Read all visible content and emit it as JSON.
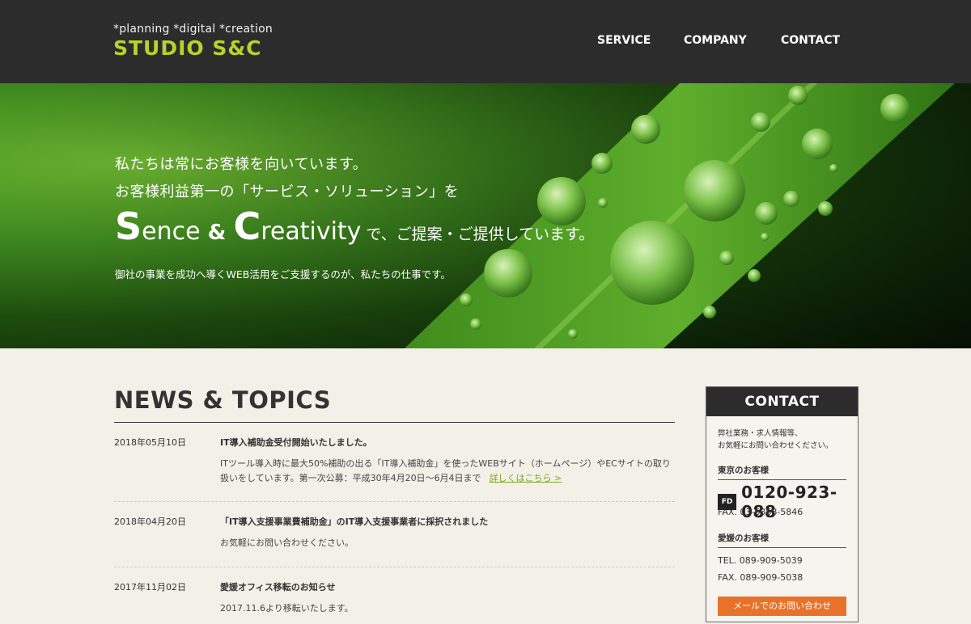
{
  "header": {
    "tagline": "*planning *digital *creation",
    "brand": "STUDIO S&C",
    "nav": [
      "SERVICE",
      "COMPANY",
      "CONTACT"
    ]
  },
  "hero": {
    "line1": "私たちは常にお客様を向いています。",
    "line2": "お客様利益第一の「サービス・ソリューション」を",
    "s_letter": "S",
    "s_rest": "ence",
    "amp": "&",
    "c_letter": "C",
    "c_rest": "reativity",
    "tail": "で、ご提案・ご提供しています。",
    "line4": "御社の事業を成功へ導くWEB活用をご支援するのが、私たちの仕事です。"
  },
  "news": {
    "heading": "NEWS & TOPICS",
    "items": [
      {
        "date": "2018年05月10日",
        "title": "IT導入補助金受付開始いたしました。",
        "body": "ITツール導入時に最大50%補助の出る「IT導入補助金」を使ったWEBサイト（ホームページ）やECサイトの取り扱いをしています。第一次公募：平成30年4月20日〜6月4日まで",
        "more": "詳しくはこちら >"
      },
      {
        "date": "2018年04月20日",
        "title": "「IT導入支援事業費補助金」のIT導入支援事業者に採択されました",
        "body": "お気軽にお問い合わせください。"
      },
      {
        "date": "2017年11月02日",
        "title": "愛媛オフィス移転のお知らせ",
        "body": "2017.11.6より移転いたします。"
      }
    ]
  },
  "sidebar": {
    "heading": "CONTACT",
    "intro1": "弊社業務・求人情報等、",
    "intro2": "お気軽にお問い合わせください。",
    "tokyo_label": "東京のお客様",
    "freedial_icon": "フリーダイヤル",
    "freedial": "0120-923-088",
    "tokyo_fax": "FAX. 03-6368-5846",
    "ehime_label": "愛媛のお客様",
    "ehime_tel": "TEL. 089-909-5039",
    "ehime_fax": "FAX. 089-909-5038",
    "button": "メールでのお問い合わせ"
  },
  "colors": {
    "header_bg": "#2c2c2c",
    "brand_green": "#b7d32b",
    "page_bg": "#f3f0e8",
    "link_green": "#7aa81a",
    "button_orange": "#e8722a"
  }
}
